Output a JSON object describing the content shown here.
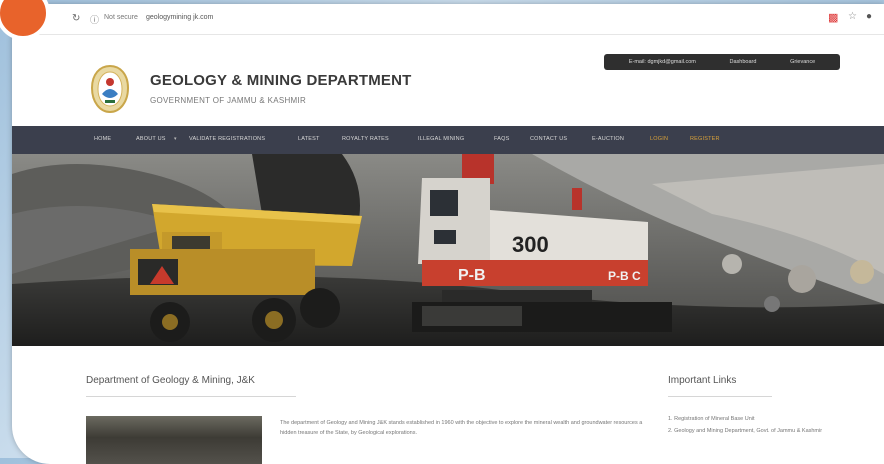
{
  "browser": {
    "security_label": "Not secure",
    "url": "geologymining jk.com"
  },
  "header": {
    "email_label": "E-mail: dgmjkd@gmail.com",
    "dashboard_label": "Dashboard",
    "grievance_label": "Grievance",
    "title": "GEOLOGY & MINING DEPARTMENT",
    "subtitle": "GOVERNMENT OF JAMMU & KASHMIR"
  },
  "nav": {
    "items": [
      {
        "label": "HOME"
      },
      {
        "label": "ABOUT US"
      },
      {
        "label": "VALIDATE REGISTRATIONS"
      },
      {
        "label": "LATEST"
      },
      {
        "label": "ROYALTY RATES"
      },
      {
        "label": "ILLEGAL MINING"
      },
      {
        "label": "FAQS"
      },
      {
        "label": "CONTACT US"
      },
      {
        "label": "E-AUCTION"
      },
      {
        "label": "LOGIN"
      },
      {
        "label": "REGISTER"
      }
    ]
  },
  "hero": {
    "shovel_number": "300",
    "shovel_code": "P-B",
    "shovel_code_2": "P-B C"
  },
  "main": {
    "section_title": "Department of Geology & Mining, J&K",
    "intro_text": "The department of Geology and Mining J&K stands established in 1960 with the objective to explore the mineral wealth and groundwater resources a hidden treasure of the State, by Geological explorations."
  },
  "sidebar": {
    "title": "Important Links",
    "links": [
      {
        "label": "1.  Registration of Mineral Base Unit"
      },
      {
        "label": "2.  Geology and Mining Department, Govt. of Jammu & Kashmir"
      }
    ]
  }
}
